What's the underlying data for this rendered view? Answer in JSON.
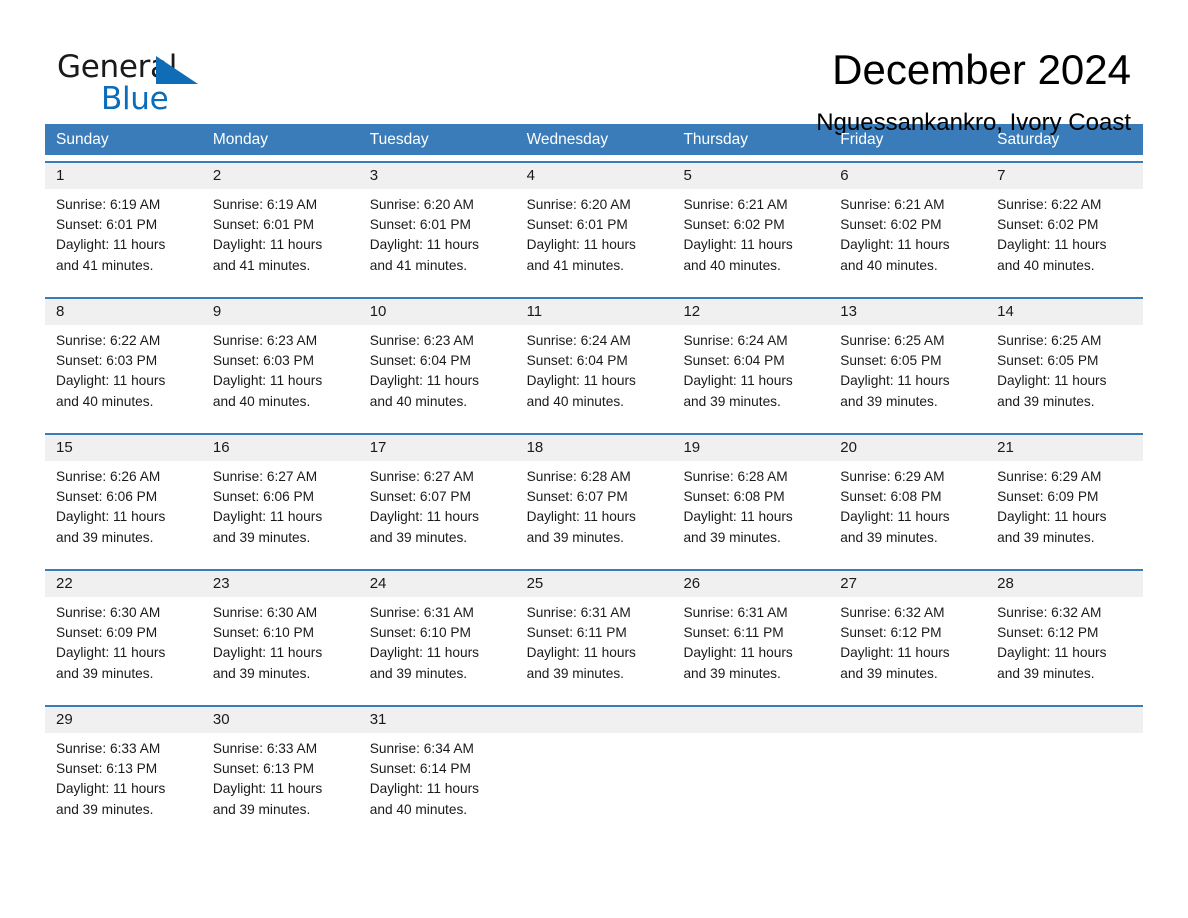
{
  "brand": {
    "name_part1": "General",
    "name_part2": "Blue",
    "triangle_color": "#0f6cb6",
    "blue_text_color": "#0a6cba"
  },
  "header": {
    "title": "December 2024",
    "subtitle": "Nguessankankro, Ivory Coast"
  },
  "theme": {
    "header_blue": "#3a7cb9",
    "date_band_gray": "#f0f0f0",
    "cell_white": "#ffffff",
    "text_black": "#1a1a1a"
  },
  "calendar": {
    "day_headers": [
      "Sunday",
      "Monday",
      "Tuesday",
      "Wednesday",
      "Thursday",
      "Friday",
      "Saturday"
    ],
    "weeks": [
      {
        "days": [
          {
            "date": "1",
            "sunrise": "Sunrise: 6:19 AM",
            "sunset": "Sunset: 6:01 PM",
            "daylight_line1": "Daylight: 11 hours",
            "daylight_line2": "and 41 minutes."
          },
          {
            "date": "2",
            "sunrise": "Sunrise: 6:19 AM",
            "sunset": "Sunset: 6:01 PM",
            "daylight_line1": "Daylight: 11 hours",
            "daylight_line2": "and 41 minutes."
          },
          {
            "date": "3",
            "sunrise": "Sunrise: 6:20 AM",
            "sunset": "Sunset: 6:01 PM",
            "daylight_line1": "Daylight: 11 hours",
            "daylight_line2": "and 41 minutes."
          },
          {
            "date": "4",
            "sunrise": "Sunrise: 6:20 AM",
            "sunset": "Sunset: 6:01 PM",
            "daylight_line1": "Daylight: 11 hours",
            "daylight_line2": "and 41 minutes."
          },
          {
            "date": "5",
            "sunrise": "Sunrise: 6:21 AM",
            "sunset": "Sunset: 6:02 PM",
            "daylight_line1": "Daylight: 11 hours",
            "daylight_line2": "and 40 minutes."
          },
          {
            "date": "6",
            "sunrise": "Sunrise: 6:21 AM",
            "sunset": "Sunset: 6:02 PM",
            "daylight_line1": "Daylight: 11 hours",
            "daylight_line2": "and 40 minutes."
          },
          {
            "date": "7",
            "sunrise": "Sunrise: 6:22 AM",
            "sunset": "Sunset: 6:02 PM",
            "daylight_line1": "Daylight: 11 hours",
            "daylight_line2": "and 40 minutes."
          }
        ]
      },
      {
        "days": [
          {
            "date": "8",
            "sunrise": "Sunrise: 6:22 AM",
            "sunset": "Sunset: 6:03 PM",
            "daylight_line1": "Daylight: 11 hours",
            "daylight_line2": "and 40 minutes."
          },
          {
            "date": "9",
            "sunrise": "Sunrise: 6:23 AM",
            "sunset": "Sunset: 6:03 PM",
            "daylight_line1": "Daylight: 11 hours",
            "daylight_line2": "and 40 minutes."
          },
          {
            "date": "10",
            "sunrise": "Sunrise: 6:23 AM",
            "sunset": "Sunset: 6:04 PM",
            "daylight_line1": "Daylight: 11 hours",
            "daylight_line2": "and 40 minutes."
          },
          {
            "date": "11",
            "sunrise": "Sunrise: 6:24 AM",
            "sunset": "Sunset: 6:04 PM",
            "daylight_line1": "Daylight: 11 hours",
            "daylight_line2": "and 40 minutes."
          },
          {
            "date": "12",
            "sunrise": "Sunrise: 6:24 AM",
            "sunset": "Sunset: 6:04 PM",
            "daylight_line1": "Daylight: 11 hours",
            "daylight_line2": "and 39 minutes."
          },
          {
            "date": "13",
            "sunrise": "Sunrise: 6:25 AM",
            "sunset": "Sunset: 6:05 PM",
            "daylight_line1": "Daylight: 11 hours",
            "daylight_line2": "and 39 minutes."
          },
          {
            "date": "14",
            "sunrise": "Sunrise: 6:25 AM",
            "sunset": "Sunset: 6:05 PM",
            "daylight_line1": "Daylight: 11 hours",
            "daylight_line2": "and 39 minutes."
          }
        ]
      },
      {
        "days": [
          {
            "date": "15",
            "sunrise": "Sunrise: 6:26 AM",
            "sunset": "Sunset: 6:06 PM",
            "daylight_line1": "Daylight: 11 hours",
            "daylight_line2": "and 39 minutes."
          },
          {
            "date": "16",
            "sunrise": "Sunrise: 6:27 AM",
            "sunset": "Sunset: 6:06 PM",
            "daylight_line1": "Daylight: 11 hours",
            "daylight_line2": "and 39 minutes."
          },
          {
            "date": "17",
            "sunrise": "Sunrise: 6:27 AM",
            "sunset": "Sunset: 6:07 PM",
            "daylight_line1": "Daylight: 11 hours",
            "daylight_line2": "and 39 minutes."
          },
          {
            "date": "18",
            "sunrise": "Sunrise: 6:28 AM",
            "sunset": "Sunset: 6:07 PM",
            "daylight_line1": "Daylight: 11 hours",
            "daylight_line2": "and 39 minutes."
          },
          {
            "date": "19",
            "sunrise": "Sunrise: 6:28 AM",
            "sunset": "Sunset: 6:08 PM",
            "daylight_line1": "Daylight: 11 hours",
            "daylight_line2": "and 39 minutes."
          },
          {
            "date": "20",
            "sunrise": "Sunrise: 6:29 AM",
            "sunset": "Sunset: 6:08 PM",
            "daylight_line1": "Daylight: 11 hours",
            "daylight_line2": "and 39 minutes."
          },
          {
            "date": "21",
            "sunrise": "Sunrise: 6:29 AM",
            "sunset": "Sunset: 6:09 PM",
            "daylight_line1": "Daylight: 11 hours",
            "daylight_line2": "and 39 minutes."
          }
        ]
      },
      {
        "days": [
          {
            "date": "22",
            "sunrise": "Sunrise: 6:30 AM",
            "sunset": "Sunset: 6:09 PM",
            "daylight_line1": "Daylight: 11 hours",
            "daylight_line2": "and 39 minutes."
          },
          {
            "date": "23",
            "sunrise": "Sunrise: 6:30 AM",
            "sunset": "Sunset: 6:10 PM",
            "daylight_line1": "Daylight: 11 hours",
            "daylight_line2": "and 39 minutes."
          },
          {
            "date": "24",
            "sunrise": "Sunrise: 6:31 AM",
            "sunset": "Sunset: 6:10 PM",
            "daylight_line1": "Daylight: 11 hours",
            "daylight_line2": "and 39 minutes."
          },
          {
            "date": "25",
            "sunrise": "Sunrise: 6:31 AM",
            "sunset": "Sunset: 6:11 PM",
            "daylight_line1": "Daylight: 11 hours",
            "daylight_line2": "and 39 minutes."
          },
          {
            "date": "26",
            "sunrise": "Sunrise: 6:31 AM",
            "sunset": "Sunset: 6:11 PM",
            "daylight_line1": "Daylight: 11 hours",
            "daylight_line2": "and 39 minutes."
          },
          {
            "date": "27",
            "sunrise": "Sunrise: 6:32 AM",
            "sunset": "Sunset: 6:12 PM",
            "daylight_line1": "Daylight: 11 hours",
            "daylight_line2": "and 39 minutes."
          },
          {
            "date": "28",
            "sunrise": "Sunrise: 6:32 AM",
            "sunset": "Sunset: 6:12 PM",
            "daylight_line1": "Daylight: 11 hours",
            "daylight_line2": "and 39 minutes."
          }
        ]
      },
      {
        "days": [
          {
            "date": "29",
            "sunrise": "Sunrise: 6:33 AM",
            "sunset": "Sunset: 6:13 PM",
            "daylight_line1": "Daylight: 11 hours",
            "daylight_line2": "and 39 minutes."
          },
          {
            "date": "30",
            "sunrise": "Sunrise: 6:33 AM",
            "sunset": "Sunset: 6:13 PM",
            "daylight_line1": "Daylight: 11 hours",
            "daylight_line2": "and 39 minutes."
          },
          {
            "date": "31",
            "sunrise": "Sunrise: 6:34 AM",
            "sunset": "Sunset: 6:14 PM",
            "daylight_line1": "Daylight: 11 hours",
            "daylight_line2": "and 40 minutes."
          },
          {
            "date": "",
            "sunrise": "",
            "sunset": "",
            "daylight_line1": "",
            "daylight_line2": ""
          },
          {
            "date": "",
            "sunrise": "",
            "sunset": "",
            "daylight_line1": "",
            "daylight_line2": ""
          },
          {
            "date": "",
            "sunrise": "",
            "sunset": "",
            "daylight_line1": "",
            "daylight_line2": ""
          },
          {
            "date": "",
            "sunrise": "",
            "sunset": "",
            "daylight_line1": "",
            "daylight_line2": ""
          }
        ]
      }
    ]
  }
}
